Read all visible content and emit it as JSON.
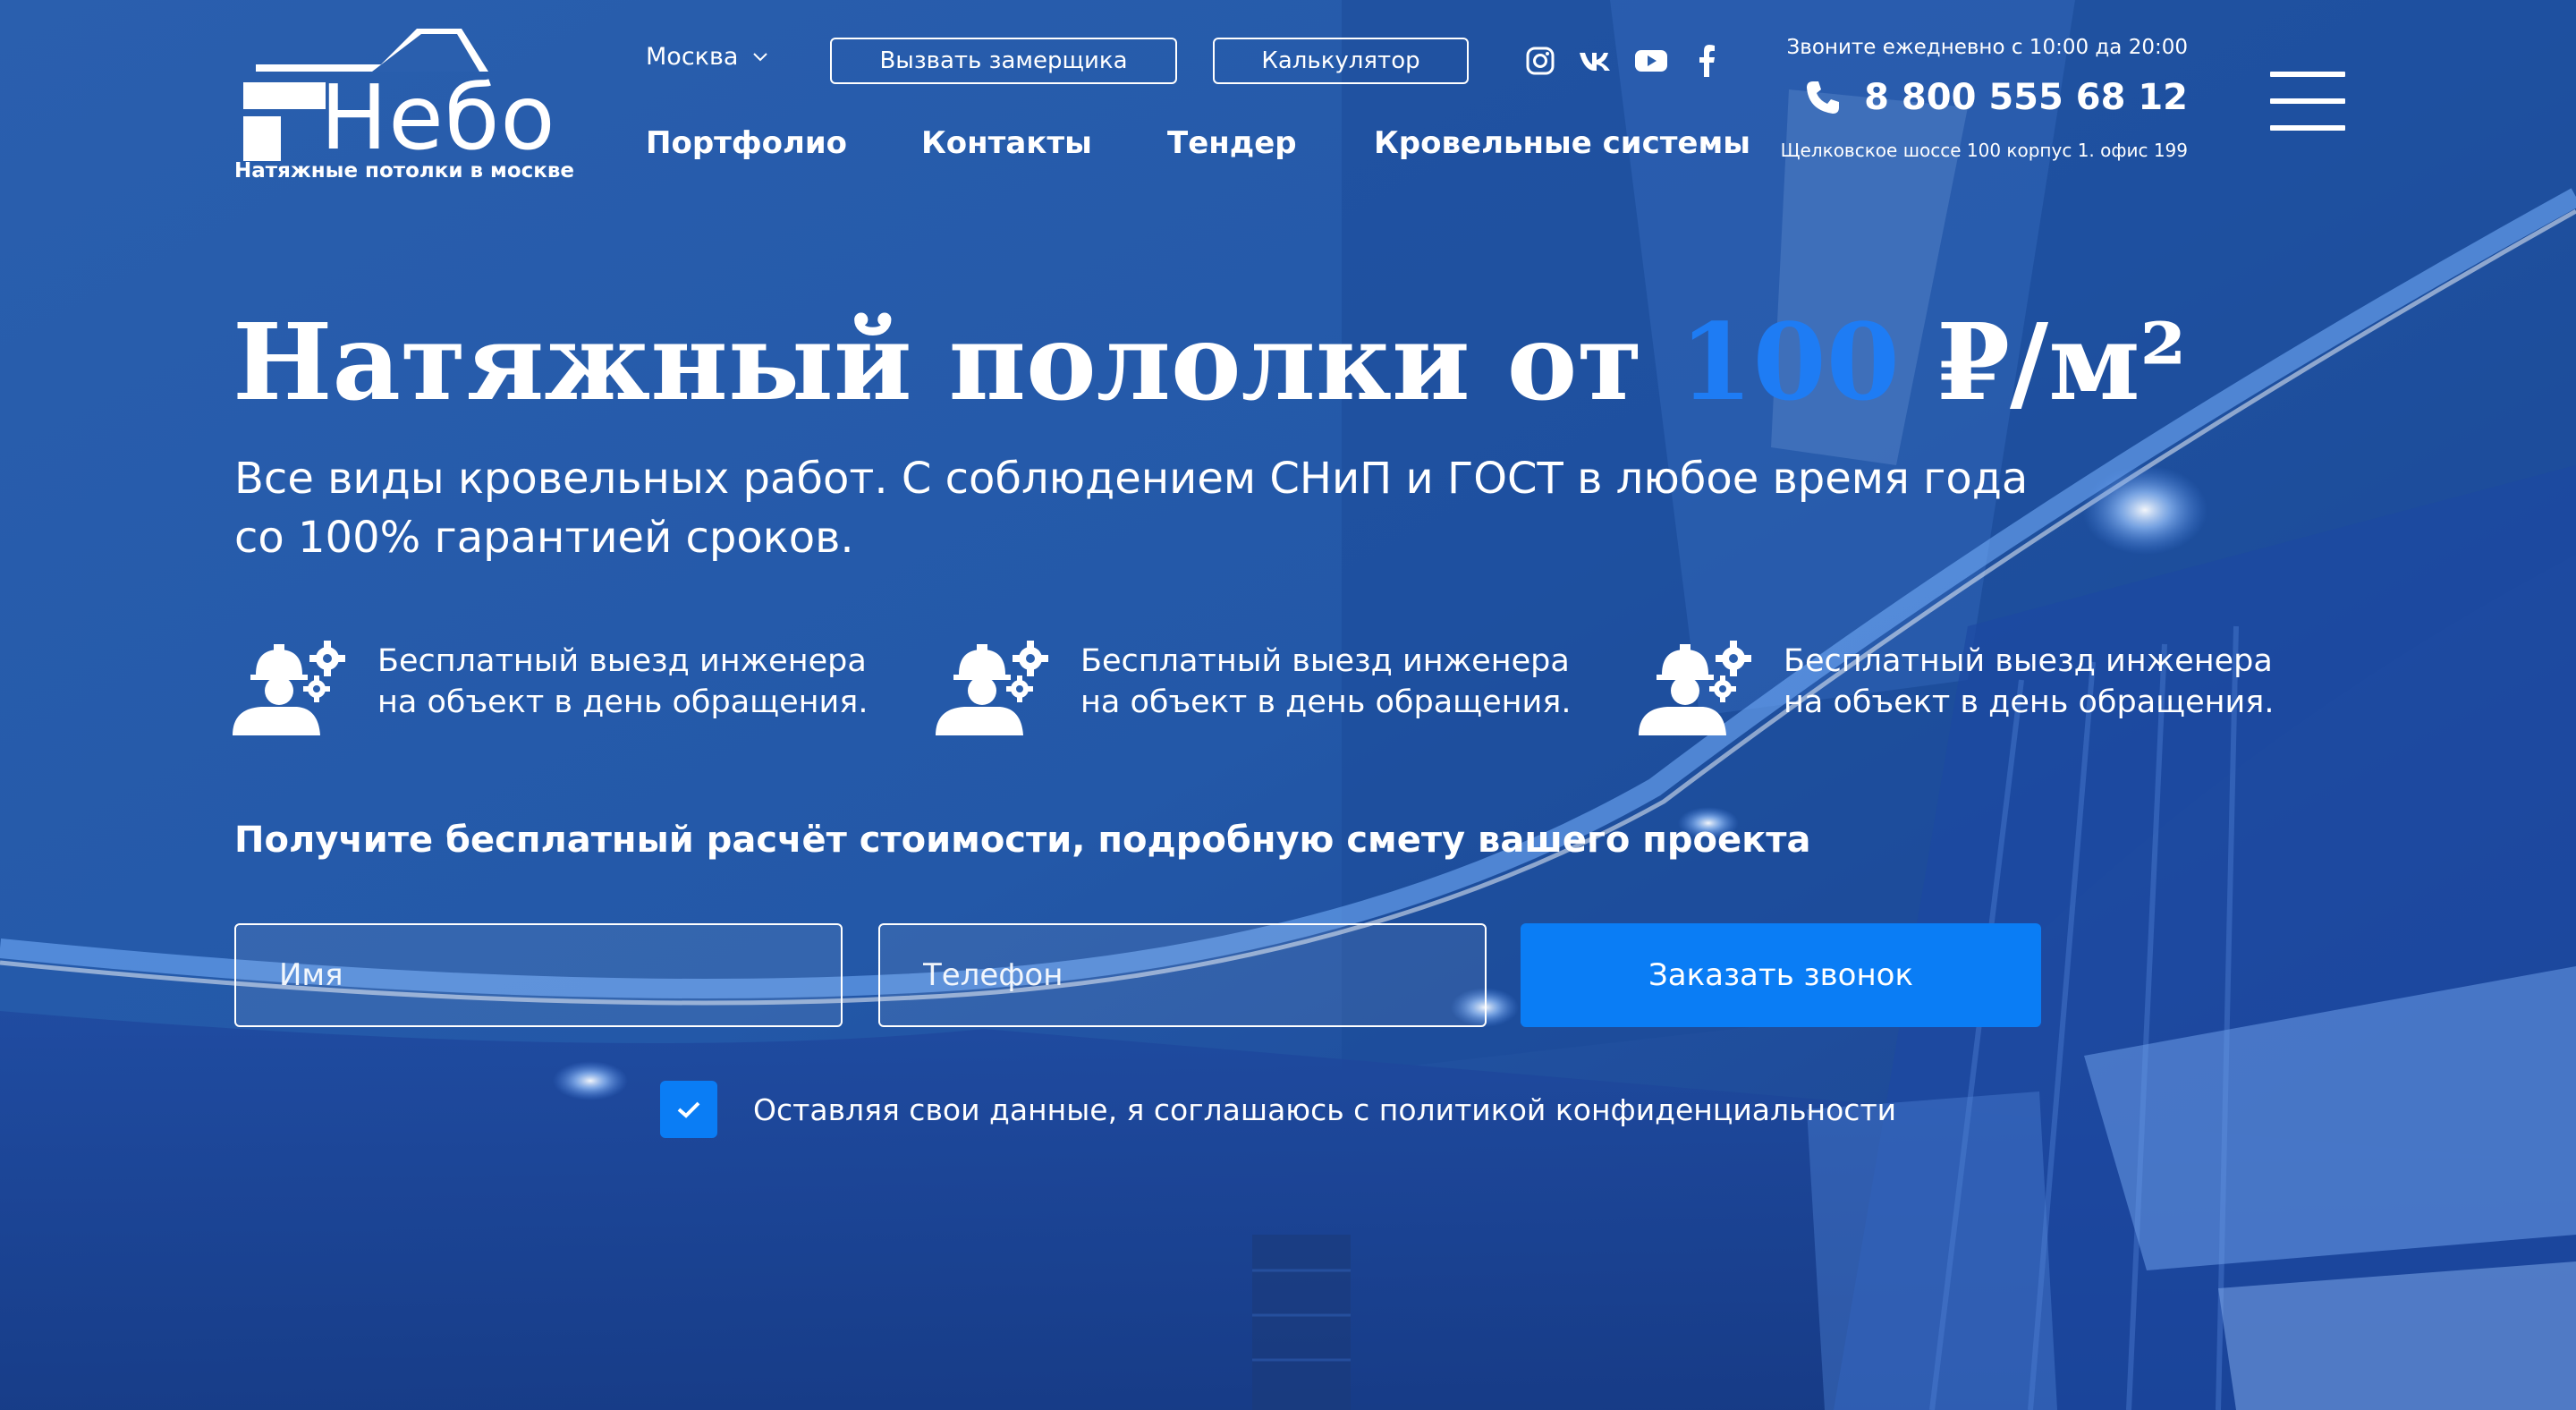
{
  "colors": {
    "accent": "#1e7cf4",
    "button": "#0a7df5",
    "background": "#1f4f9c",
    "text": "#ffffff"
  },
  "header": {
    "logo": {
      "name": "Небо",
      "subtitle": "Натяжные потолки в москве"
    },
    "city": "Москва",
    "buttons": {
      "measure": "Вызвать замерщика",
      "calculator": "Калькулятор"
    },
    "social": [
      {
        "icon": "instagram-icon"
      },
      {
        "icon": "vk-icon"
      },
      {
        "icon": "youtube-icon"
      },
      {
        "icon": "facebook-icon"
      }
    ],
    "nav": [
      "Портфолио",
      "Контакты",
      "Тендер",
      "Кровельные системы"
    ],
    "contacts": {
      "hours": "Звоните ежедневно с 10:00 да 20:00",
      "phone": "8 800 555 68 12",
      "address": "Щелковское шоссе 100 корпус 1. офис 199"
    },
    "menu_icon": "hamburger-menu-icon"
  },
  "hero": {
    "title_prefix": "Натяжный пололки от ",
    "title_price": "100",
    "title_suffix": " ₽/м²",
    "subtitle_lines": [
      "Все виды кровельных работ. С соблюдением СНиП и ГОСТ в любое время года",
      "со 100% гарантией сроков."
    ],
    "features": [
      {
        "icon": "engineer-gears-icon",
        "lines": [
          "Бесплатный выезд инженера",
          "на объект в день обращения."
        ]
      },
      {
        "icon": "engineer-gears-icon",
        "lines": [
          "Бесплатный выезд инженера",
          "на объект в день обращения."
        ]
      },
      {
        "icon": "engineer-gears-icon",
        "lines": [
          "Бесплатный выезд инженера",
          "на объект в день обращения."
        ]
      }
    ]
  },
  "form": {
    "title": "Получите бесплатный расчёт стоимости, подробную смету вашего проекта",
    "name_placeholder": "Имя",
    "phone_placeholder": "Телефон",
    "submit_label": "Заказать звонок",
    "consent_checked": true,
    "consent_text": "Оставляя свои данные, я соглашаюсь с политикой конфиденциальности"
  }
}
